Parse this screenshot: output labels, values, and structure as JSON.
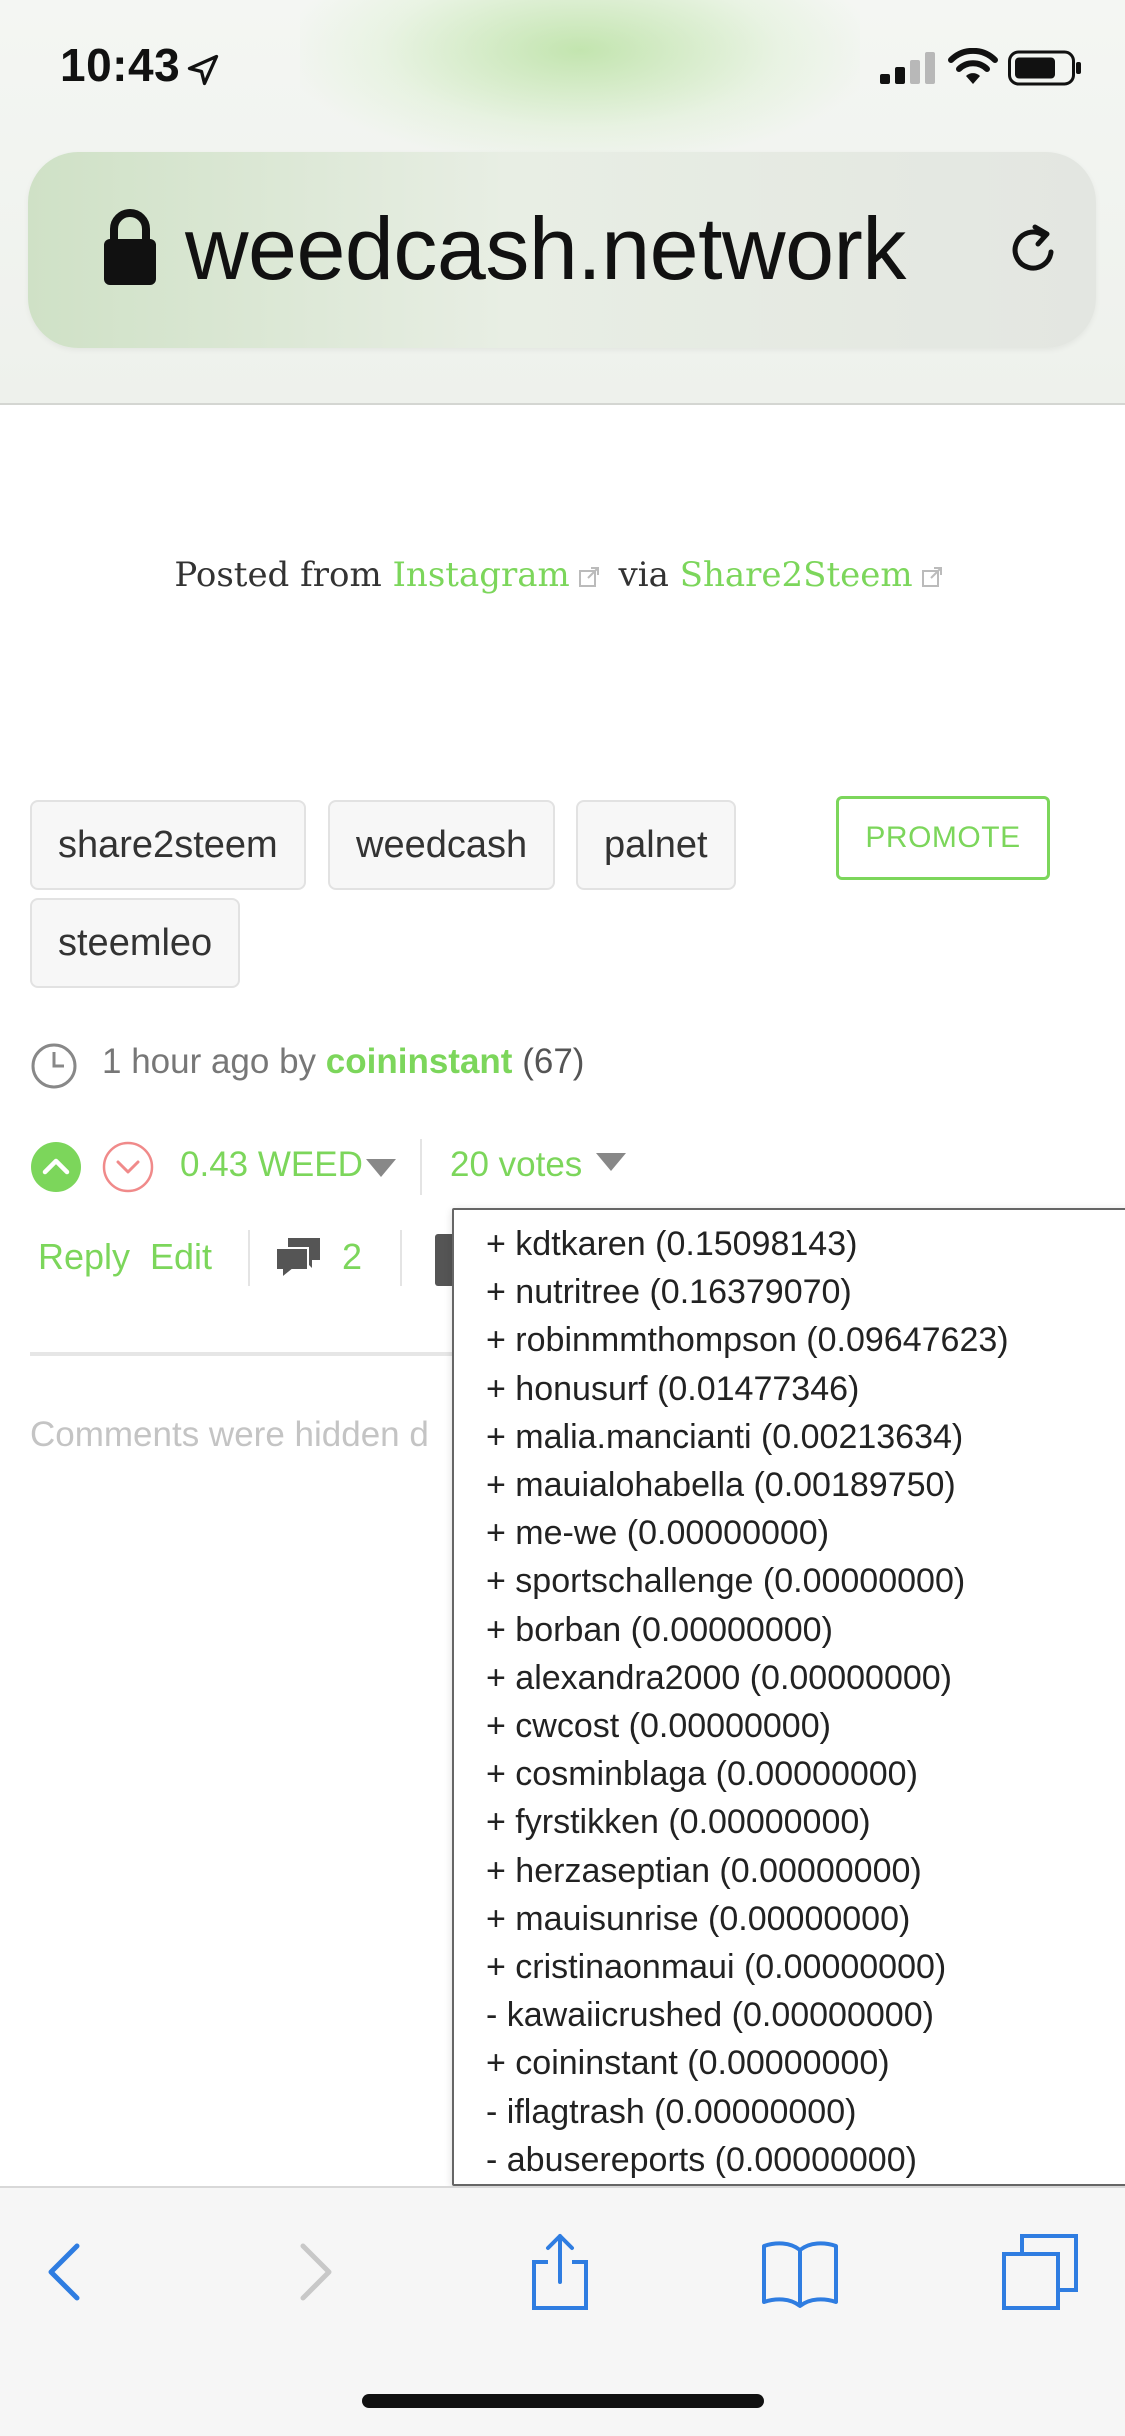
{
  "status_bar": {
    "time": "10:43"
  },
  "browser": {
    "url": "weedcash.network"
  },
  "post": {
    "posted_prefix": "Posted from ",
    "source_link": "Instagram",
    "via_text": " via ",
    "app_link": "Share2Steem"
  },
  "tags": [
    "share2steem",
    "weedcash",
    "palnet",
    "steemleo"
  ],
  "promote_label": "PROMOTE",
  "meta": {
    "time_ago": "1 hour ago by ",
    "author": "coininstant",
    "reputation": " (67)"
  },
  "votes": {
    "payout": "0.43 WEED",
    "count_label": "20 votes"
  },
  "actions": {
    "reply": "Reply",
    "edit": "Edit",
    "comment_count": "2"
  },
  "comments_note": "Comments were hidden d",
  "voters": [
    "+ kdtkaren (0.15098143)",
    "+ nutritree (0.16379070)",
    "+ robinmmthompson (0.09647623)",
    "+ honusurf (0.01477346)",
    "+ malia.mancianti (0.00213634)",
    "+ mauialohabella (0.00189750)",
    "+ me-we (0.00000000)",
    "+ sportschallenge (0.00000000)",
    "+ borban (0.00000000)",
    "+ alexandra2000 (0.00000000)",
    "+ cwcost (0.00000000)",
    "+ cosminblaga (0.00000000)",
    "+ fyrstikken (0.00000000)",
    "+ herzaseptian (0.00000000)",
    "+ mauisunrise (0.00000000)",
    "+ cristinaonmaui (0.00000000)",
    "- kawaiicrushed (0.00000000)",
    "+ coininstant (0.00000000)",
    "- iflagtrash (0.00000000)",
    "- abusereports (0.00000000)"
  ],
  "colors": {
    "accent": "#7cd65b",
    "toolbar_icon": "#2f7de1"
  },
  "icons": {
    "toolbar": [
      "back-icon",
      "forward-icon",
      "share-icon",
      "bookmarks-icon",
      "tabs-icon"
    ]
  }
}
